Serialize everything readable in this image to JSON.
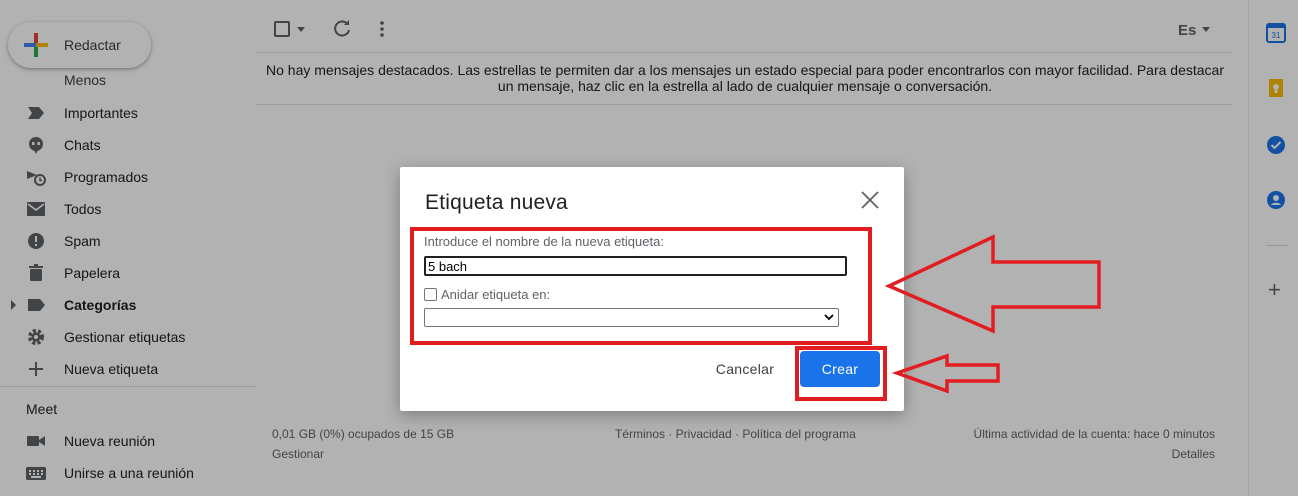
{
  "nav": {
    "compose_label": "Redactar",
    "cut_item": "Menos",
    "items": [
      {
        "label": "Importantes",
        "icon": "label-important-icon"
      },
      {
        "label": "Chats",
        "icon": "chat-icon"
      },
      {
        "label": "Programados",
        "icon": "scheduled-icon"
      },
      {
        "label": "Todos",
        "icon": "all-mail-icon"
      },
      {
        "label": "Spam",
        "icon": "spam-icon"
      },
      {
        "label": "Papelera",
        "icon": "trash-icon"
      },
      {
        "label": "Categorías",
        "icon": "label-icon"
      },
      {
        "label": "Gestionar etiquetas",
        "icon": "gear-icon"
      },
      {
        "label": "Nueva etiqueta",
        "icon": "plus-icon"
      }
    ],
    "meet_title": "Meet",
    "meet_items": [
      {
        "label": "Nueva reunión",
        "icon": "video-icon"
      },
      {
        "label": "Unirse a una reunión",
        "icon": "keyboard-icon"
      }
    ]
  },
  "toolbar": {
    "language": "Es"
  },
  "main": {
    "empty_message": "No hay mensajes destacados. Las estrellas te permiten dar a los mensajes un estado especial para poder encontrarlos con mayor facilidad. Para destacar un mensaje, haz clic en la estrella al lado de cualquier mensaje o conversación."
  },
  "footer": {
    "storage": "0,01 GB (0%) ocupados de 15 GB",
    "manage": "Gestionar",
    "links": "Términos · Privacidad · Política del programa",
    "activity": "Última actividad de la cuenta: hace 0 minutos",
    "details": "Detalles"
  },
  "side_panel": {
    "calendar_day": "31"
  },
  "dialog": {
    "title": "Etiqueta nueva",
    "name_label": "Introduce el nombre de la nueva etiqueta:",
    "name_value": "5 bach",
    "nest_label": "Anidar etiqueta en:",
    "nest_checked": false,
    "select_value": "",
    "cancel_label": "Cancelar",
    "create_label": "Crear"
  },
  "colors": {
    "accent_blue": "#1a73e8",
    "annotation_red": "#e11d22"
  }
}
